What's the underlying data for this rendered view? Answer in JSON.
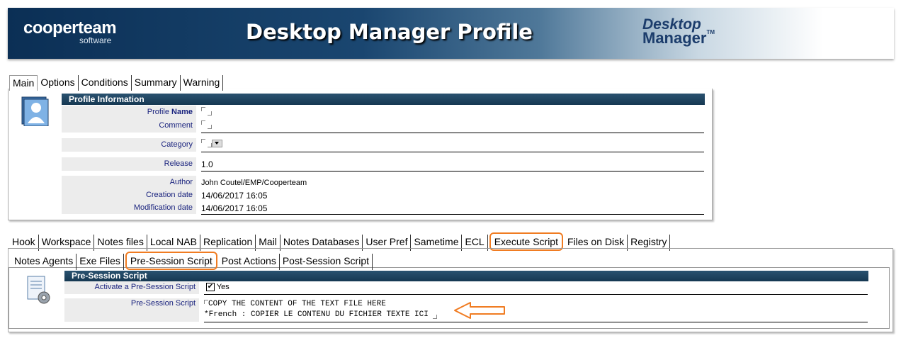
{
  "header": {
    "logo_main": "cooperteam",
    "logo_sub": "software",
    "title": "Desktop Manager Profile",
    "dm_logo_line1": "Desktop",
    "dm_logo_line2": "Manager",
    "dm_logo_tm": "TM"
  },
  "top_tabs": [
    {
      "label": "Main",
      "active": true
    },
    {
      "label": "Options"
    },
    {
      "label": "Conditions"
    },
    {
      "label": "Summary"
    },
    {
      "label": "Warning"
    }
  ],
  "profile_info": {
    "section_title": "Profile Information",
    "name_label_prefix": "Profile ",
    "name_label_bold": "Name",
    "comment_label": "Comment",
    "category_label": "Category",
    "release_label": "Release",
    "release_value": "1.0",
    "author_label": "Author",
    "author_value": "John Coutel/EMP/Cooperteam",
    "creation_label": "Creation date",
    "creation_value": "14/06/2017 16:05",
    "modification_label": "Modification date",
    "modification_value": "14/06/2017 16:05"
  },
  "main_tabs": [
    {
      "label": "Hook"
    },
    {
      "label": "Workspace"
    },
    {
      "label": "Notes files"
    },
    {
      "label": "Local NAB"
    },
    {
      "label": "Replication"
    },
    {
      "label": "Mail"
    },
    {
      "label": "Notes Databases"
    },
    {
      "label": "User Pref"
    },
    {
      "label": "Sametime"
    },
    {
      "label": "ECL"
    },
    {
      "label": "Execute Script",
      "highlighted": true
    },
    {
      "label": "Files on Disk"
    },
    {
      "label": "Registry"
    }
  ],
  "sub_tabs": [
    {
      "label": "Notes Agents"
    },
    {
      "label": "Exe Files"
    },
    {
      "label": "Pre-Session Script",
      "highlighted": true
    },
    {
      "label": "Post Actions"
    },
    {
      "label": "Post-Session Script"
    }
  ],
  "pre_session": {
    "section_title": "Pre-Session Script",
    "activate_label": "Activate a Pre-Session Script",
    "activate_checked": true,
    "activate_value": "Yes",
    "script_label": "Pre-Session Script",
    "script_line1": "COPY THE CONTENT OF THE TEXT FILE HERE",
    "script_line2": "*French : COPIER LE CONTENU DU FICHIER TEXTE ICI"
  },
  "colors": {
    "accent_highlight": "#f07c22",
    "section_bar": "#1f4762",
    "label_text": "#1a237e"
  }
}
